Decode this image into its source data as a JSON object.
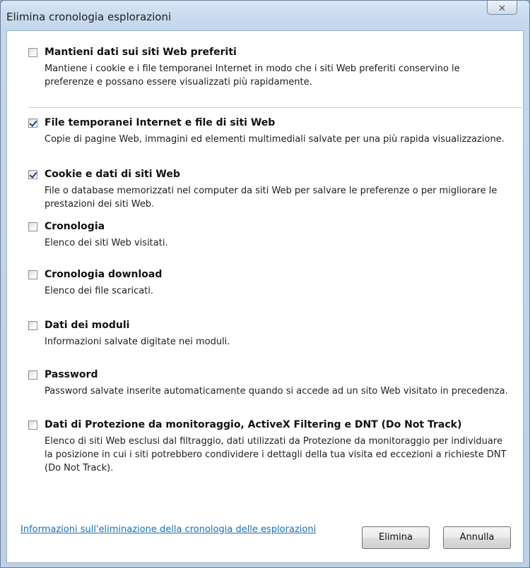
{
  "window": {
    "title": "Elimina cronologia esplorazioni",
    "close_glyph": "✕"
  },
  "options": [
    {
      "title": "Mantieni dati sui siti Web preferiti",
      "description": "Mantiene i cookie e i file temporanei Internet in modo che i siti Web preferiti conservino le preferenze e possano essere visualizzati più rapidamente.",
      "checked": false
    },
    {
      "title": "File temporanei Internet e file di siti Web",
      "description": "Copie di pagine Web, immagini ed elementi multimediali salvate per una più rapida visualizzazione.",
      "checked": true
    },
    {
      "title": "Cookie e dati di siti Web",
      "description": "File o database memorizzati nel computer da siti Web per salvare le preferenze o per migliorare le prestazioni dei siti Web.",
      "checked": true
    },
    {
      "title": "Cronologia",
      "description": "Elenco dei siti Web visitati.",
      "checked": false
    },
    {
      "title": "Cronologia download",
      "description": "Elenco dei file scaricati.",
      "checked": false
    },
    {
      "title": "Dati dei moduli",
      "description": "Informazioni salvate digitate nei moduli.",
      "checked": false
    },
    {
      "title": "Password",
      "description": "Password salvate inserite automaticamente quando si accede ad un sito Web visitato in precedenza.",
      "checked": false
    },
    {
      "title": "Dati di Protezione da monitoraggio, ActiveX Filtering e DNT (Do Not Track)",
      "description": "Elenco di siti Web esclusi dal filtraggio, dati utilizzati da Protezione da monitoraggio per individuare la posizione in cui i siti potrebbero condividere i dettagli della tua visita ed eccezioni a richieste DNT (Do Not Track).",
      "checked": false
    }
  ],
  "footer": {
    "link_text": "Informazioni sull'eliminazione della cronologia delle esplorazioni",
    "delete_label": "Elimina",
    "cancel_label": "Annulla"
  },
  "colors": {
    "link": "#1a6fb9",
    "checkmark": "#1b3e87",
    "title_bar": "#c9dbee"
  }
}
